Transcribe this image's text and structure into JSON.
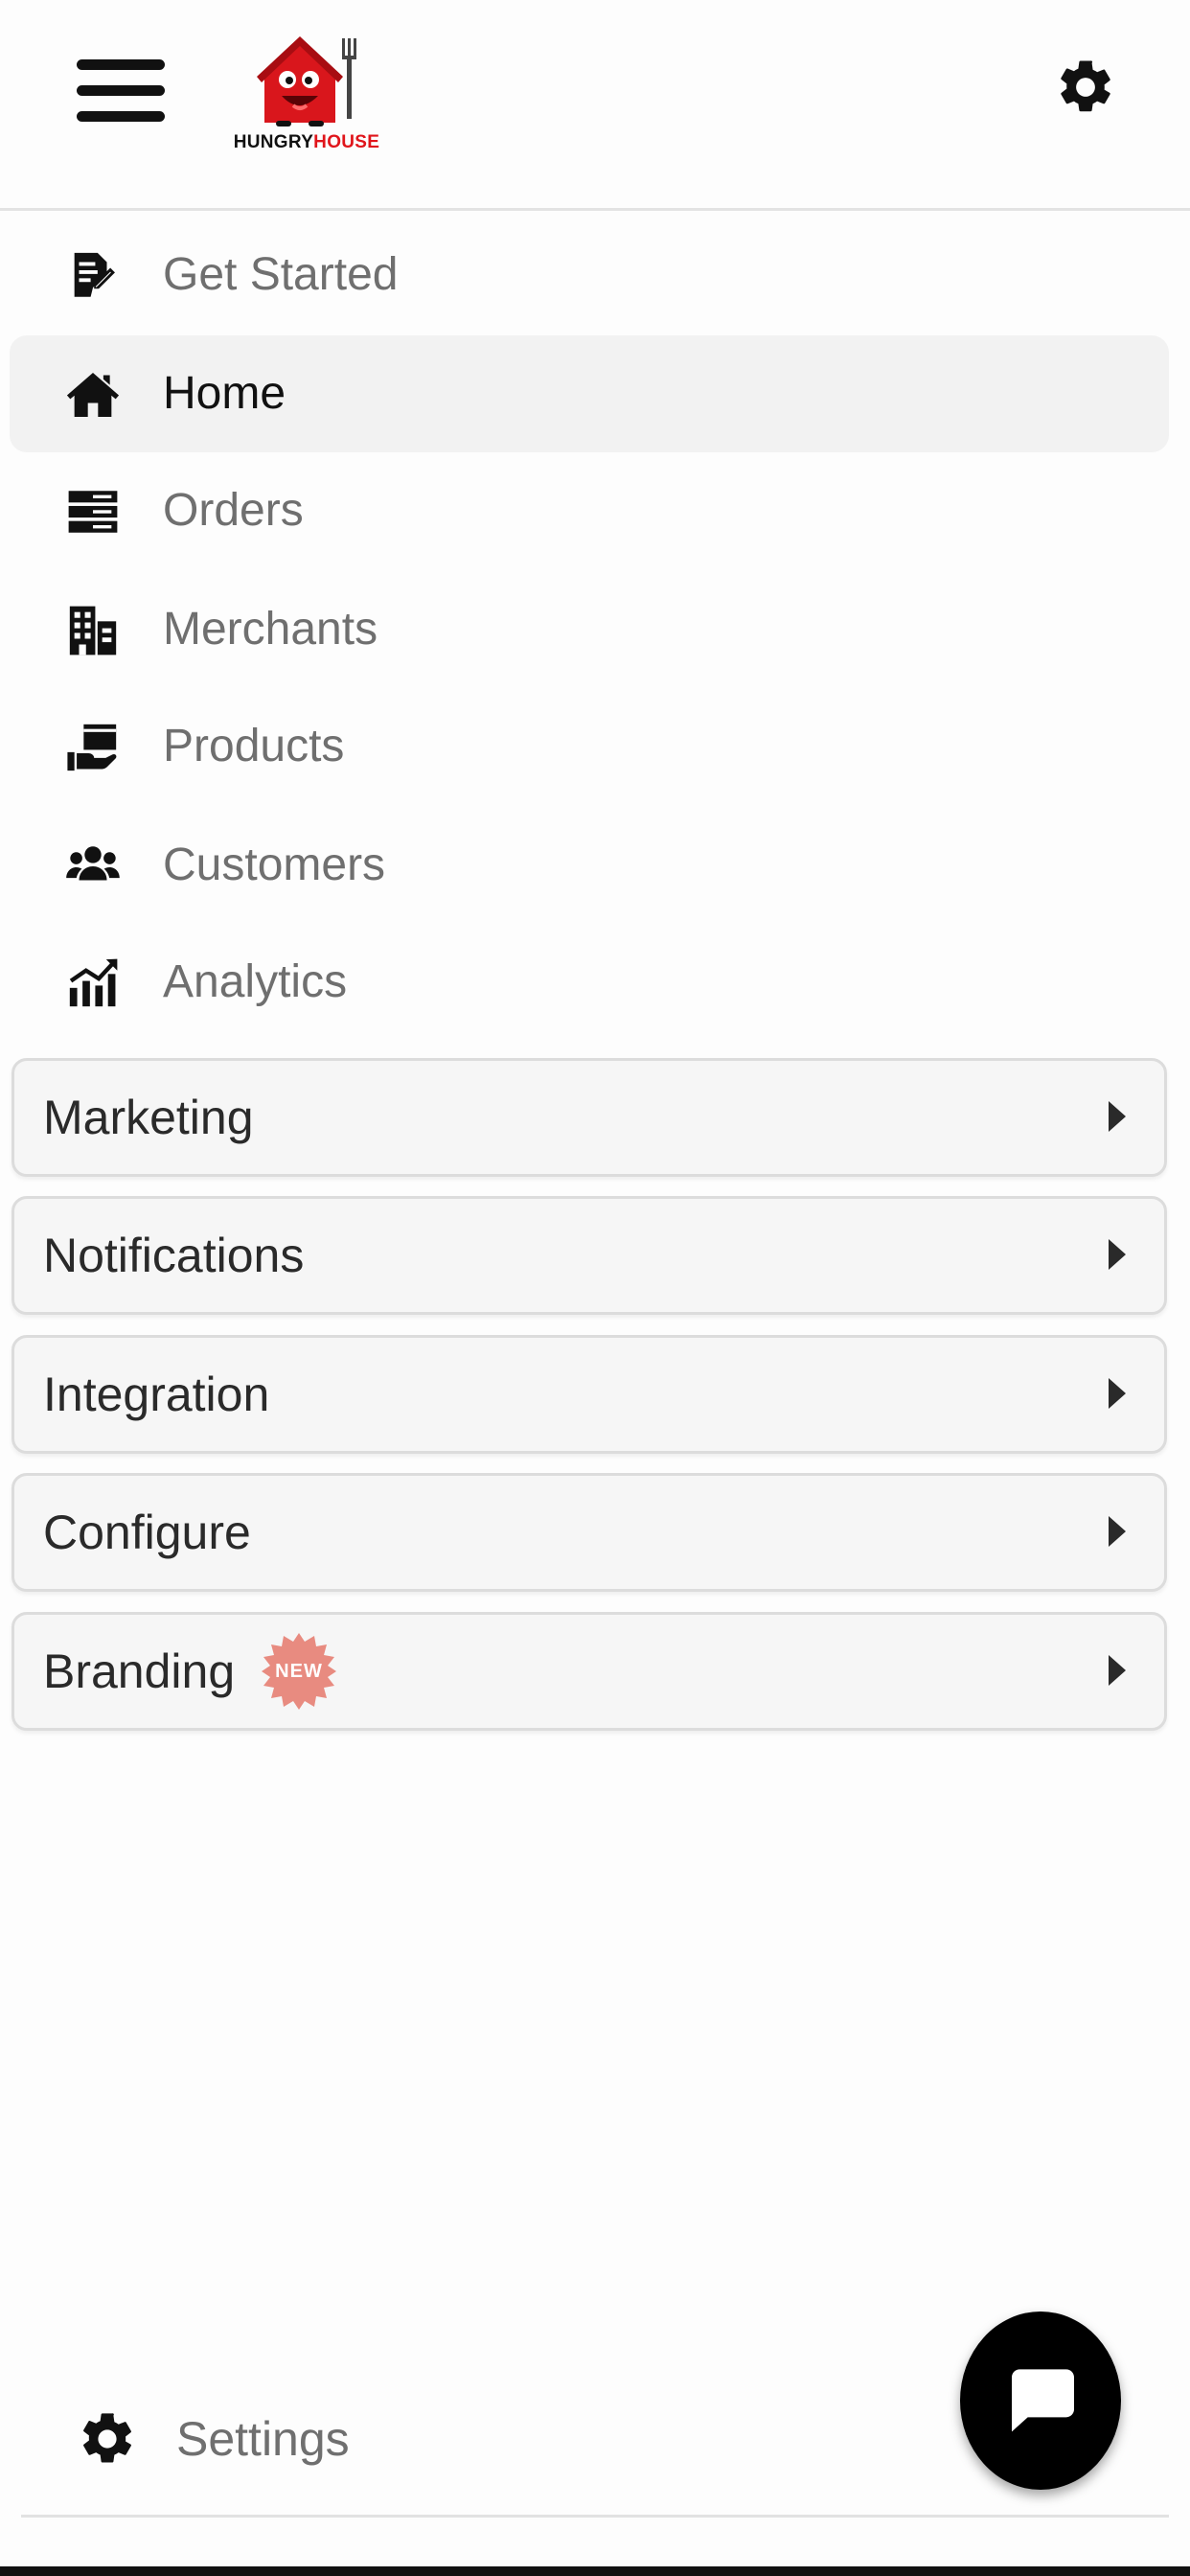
{
  "header": {
    "menu_icon": "hamburger-menu-icon",
    "logo": {
      "word1": "HUNGRY",
      "word2": "HOUSE",
      "colors": {
        "dark": "#111111",
        "red": "#e0151b"
      }
    },
    "settings_icon": "gear-icon"
  },
  "nav": {
    "active": "Home",
    "items": [
      {
        "label": "Get Started",
        "icon": "edit-document-icon"
      },
      {
        "label": "Home",
        "icon": "home-icon"
      },
      {
        "label": "Orders",
        "icon": "server-stack-icon"
      },
      {
        "label": "Merchants",
        "icon": "building-icon"
      },
      {
        "label": "Products",
        "icon": "box-in-hand-icon"
      },
      {
        "label": "Customers",
        "icon": "users-icon"
      },
      {
        "label": "Analytics",
        "icon": "chart-bar-icon"
      }
    ]
  },
  "groups": [
    {
      "label": "Marketing"
    },
    {
      "label": "Notifications"
    },
    {
      "label": "Integration"
    },
    {
      "label": "Configure"
    },
    {
      "label": "Branding",
      "badge": "NEW",
      "badge_color": "#e88b80"
    }
  ],
  "footer": {
    "settings_label": "Settings",
    "settings_icon": "gear-icon",
    "chat_icon": "chat-bubble-icon"
  }
}
